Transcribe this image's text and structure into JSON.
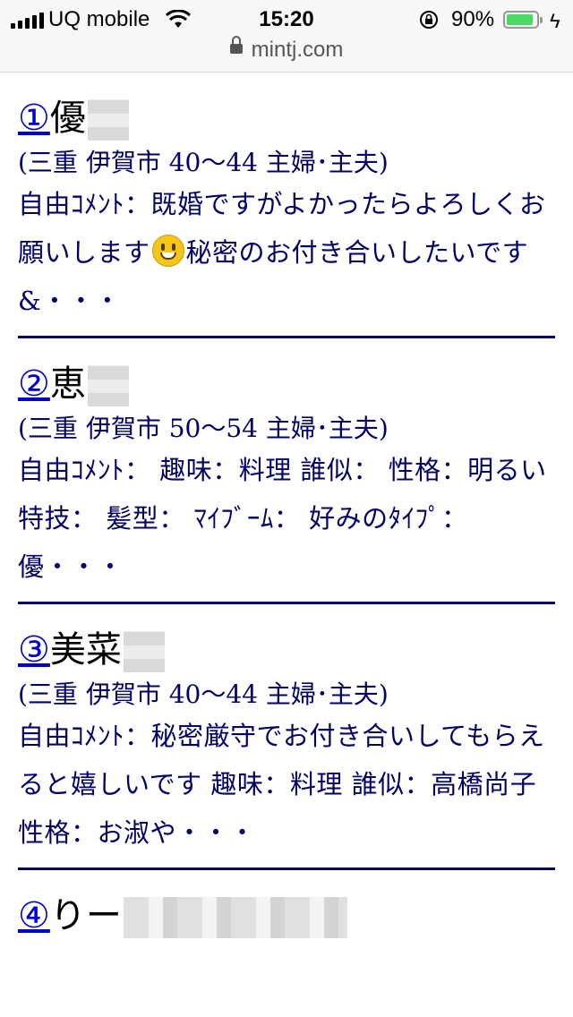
{
  "status_bar": {
    "carrier": "UQ mobile",
    "time": "15:20",
    "battery_percent": "90%",
    "battery_level": 0.9,
    "battery_color": "#4cd964",
    "url": "mintj.com"
  },
  "entries": [
    {
      "number": "①",
      "name": "優",
      "meta": "(三重 伊賀市 40〜44 主婦･主夫)",
      "comment_before": "自由ｺﾒﾝﾄ：既婚ですがよかったらよろしくお願いします",
      "comment_after": "秘密のお付き合いしたいです&・・・",
      "emoji": "grinning-face-emoji"
    },
    {
      "number": "②",
      "name": "恵",
      "meta": "(三重 伊賀市 50〜54 主婦･主夫)",
      "comment": "自由ｺﾒﾝﾄ： 趣味：料理 誰似： 性格：明るい 特技： 髪型： ﾏｲﾌﾞｰﾑ： 好みのﾀｲﾌﾟ：優・・・"
    },
    {
      "number": "③",
      "name": "美菜",
      "meta": "(三重 伊賀市 40〜44 主婦･主夫)",
      "comment": "自由ｺﾒﾝﾄ：秘密厳守でお付き合いしてもらえると嬉しいです 趣味：料理 誰似：高橋尚子 性格：お淑や・・・"
    },
    {
      "number": "④",
      "name": "りー"
    }
  ],
  "colors": {
    "link": "#0000cc",
    "text": "#000066",
    "divider": "#000066"
  }
}
